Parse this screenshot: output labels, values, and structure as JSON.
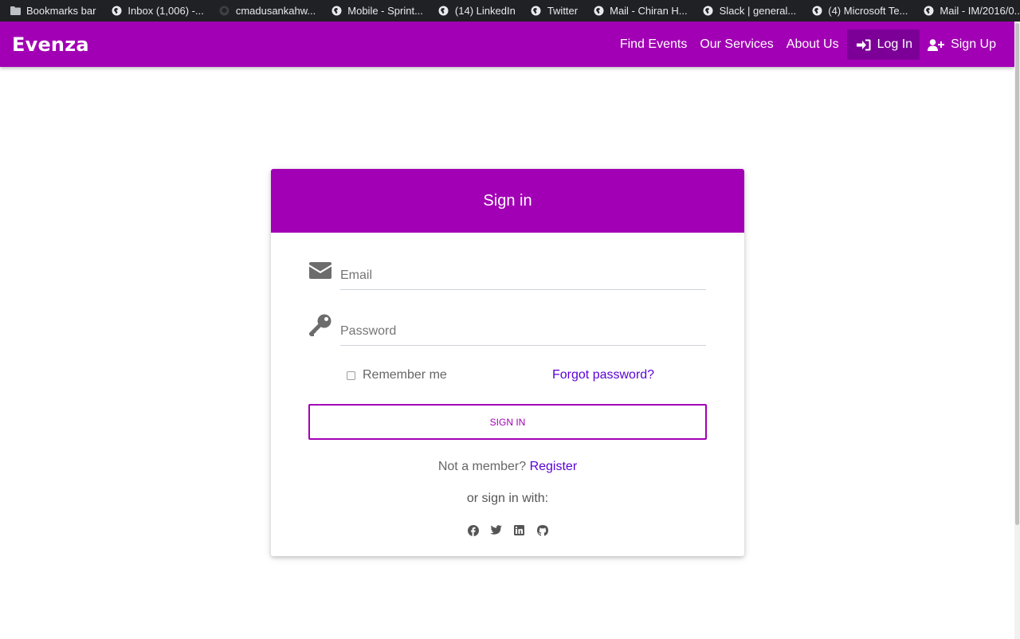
{
  "bookmarks": [
    {
      "label": "Bookmarks bar",
      "icon": "folder-icon"
    },
    {
      "label": "Inbox (1,006) -...",
      "icon": "globe-icon"
    },
    {
      "label": "cmadusankahw...",
      "icon": "github-icon"
    },
    {
      "label": "Mobile - Sprint...",
      "icon": "globe-icon"
    },
    {
      "label": "(14) LinkedIn",
      "icon": "globe-icon"
    },
    {
      "label": "Twitter",
      "icon": "globe-icon"
    },
    {
      "label": "Mail - Chiran H...",
      "icon": "globe-icon"
    },
    {
      "label": "Slack | general...",
      "icon": "globe-icon"
    },
    {
      "label": "(4) Microsoft Te...",
      "icon": "globe-icon"
    },
    {
      "label": "Mail - IM/2016/0...",
      "icon": "globe-icon"
    }
  ],
  "navbar": {
    "brand": "Evenza",
    "links": {
      "find_events": "Find Events",
      "our_services": "Our Services",
      "about_us": "About Us",
      "log_in": "Log In",
      "sign_up": "Sign Up"
    }
  },
  "card": {
    "title": "Sign in",
    "email_placeholder": "Email",
    "password_placeholder": "Password",
    "remember_label": "Remember me",
    "forgot_label": "Forgot password?",
    "submit_label": "SIGN IN",
    "not_member": "Not a member?",
    "register_label": "Register",
    "or_sign_in_with": "or sign in with:",
    "socials": [
      "facebook-icon",
      "twitter-icon",
      "linkedin-icon",
      "github-icon"
    ]
  },
  "colors": {
    "brand": "#a200b4",
    "active_nav": "#7c0097",
    "link": "#5a00d6"
  }
}
